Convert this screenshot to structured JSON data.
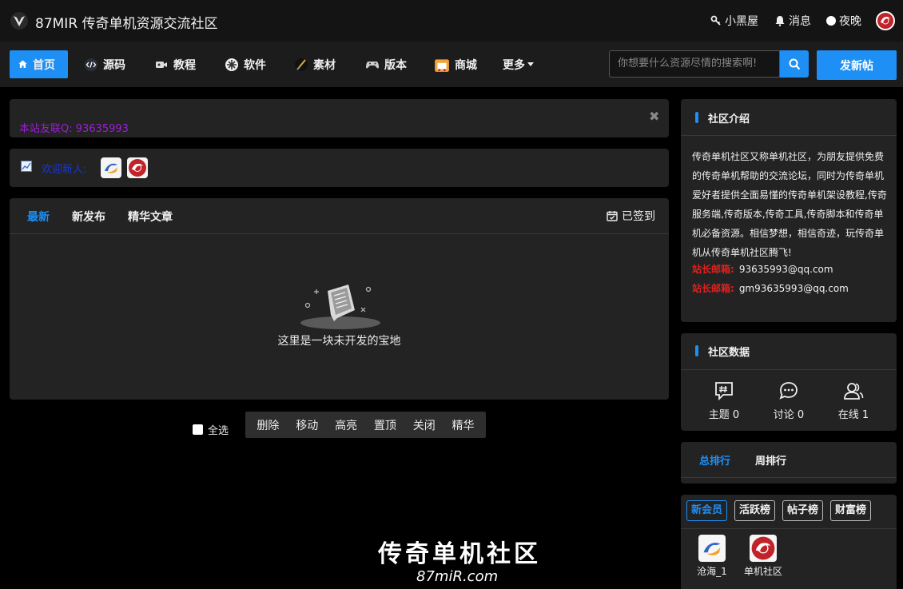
{
  "header": {
    "site_title": "87MIR 传奇单机资源交流社区",
    "links": [
      {
        "label": "小黑屋",
        "icon": "key-icon"
      },
      {
        "label": "消息",
        "icon": "bell-icon"
      },
      {
        "label": "夜晚",
        "icon": "moon-dot-icon"
      }
    ]
  },
  "nav": {
    "items": [
      {
        "label": "首页",
        "icon": "home-icon"
      },
      {
        "label": "源码",
        "icon": "code-icon"
      },
      {
        "label": "教程",
        "icon": "video-icon"
      },
      {
        "label": "软件",
        "icon": "software-icon"
      },
      {
        "label": "素材",
        "icon": "brush-icon"
      },
      {
        "label": "版本",
        "icon": "gamepad-icon"
      },
      {
        "label": "商城",
        "icon": "shop-icon"
      },
      {
        "label": "更多",
        "icon": "caret-down-icon"
      }
    ],
    "search_placeholder": "你想要什么资源尽情的搜索啊!",
    "post_button": "发新帖"
  },
  "notice": {
    "text": "本站友联Q: 93635993"
  },
  "welcome": {
    "label": "欢迎新人:"
  },
  "feed": {
    "tabs": [
      "最新",
      "新发布",
      "精华文章"
    ],
    "checkin": "已签到",
    "empty_text": "这里是一块未开发的宝地"
  },
  "bulk": {
    "select_all": "全选",
    "actions": [
      "删除",
      "移动",
      "高亮",
      "置顶",
      "关闭",
      "精华"
    ]
  },
  "watermark": {
    "title": "传奇单机社区",
    "url": "87miR.com"
  },
  "sidebar": {
    "intro_title": "社区介绍",
    "intro_text": "传奇单机社区又称单机社区，为朋友提供免费的传奇单机帮助的交流论坛，同时为传奇单机爱好者提供全面易懂的传奇单机架设教程,传奇服务端,传奇版本,传奇工具,传奇脚本和传奇单机必备资源。相信梦想，相信奇迹，玩传奇单机从传奇单机社区腾飞!",
    "mails": [
      {
        "key": "站长邮箱:",
        "value": "93635993@qq.com"
      },
      {
        "key": "站长邮箱:",
        "value": "gm93635993@qq.com"
      }
    ],
    "data_title": "社区数据",
    "stats": [
      {
        "label": "主题 0",
        "icon": "topic-icon"
      },
      {
        "label": "讨论 0",
        "icon": "chat-icon"
      },
      {
        "label": "在线 1",
        "icon": "users-icon"
      }
    ],
    "rank_tabs": [
      "总排行",
      "周排行"
    ],
    "member_tabs": [
      "新会员",
      "活跃榜",
      "帖子榜",
      "财富榜"
    ],
    "members": [
      {
        "name": "沧海_1"
      },
      {
        "name": "单机社区"
      }
    ]
  },
  "colors": {
    "accent": "#1e8ff5",
    "notice": "#9b1fd6",
    "mail_key": "#e02020"
  }
}
